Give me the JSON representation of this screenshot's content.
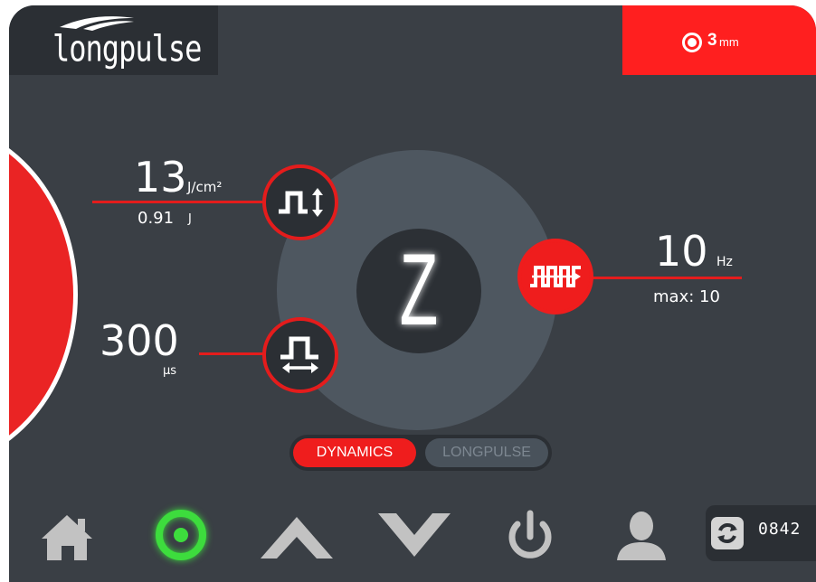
{
  "logo": {
    "text": "longpulse"
  },
  "spot": {
    "value": "3",
    "unit": "mm"
  },
  "fluence": {
    "value": "13",
    "unit": "J/cm²",
    "energy": "0.91",
    "energy_unit": "J"
  },
  "pulse_width": {
    "value": "300",
    "unit": "µs"
  },
  "frequency": {
    "value": "10",
    "unit": "Hz",
    "max_label": "max: 10"
  },
  "dial": {
    "letter": "Z"
  },
  "mode": {
    "active": "DYNAMICS",
    "inactive": "LONGPULSE"
  },
  "counter": {
    "value": "0842"
  },
  "colors": {
    "accent": "#e41c1c",
    "background": "#3a3f45",
    "dark_panel": "#2b2f34",
    "ready_green": "#3ddc3d"
  },
  "icons": [
    "home-icon",
    "ready-icon",
    "up-arrow-icon",
    "down-arrow-icon",
    "power-icon",
    "user-icon",
    "refresh-icon"
  ]
}
